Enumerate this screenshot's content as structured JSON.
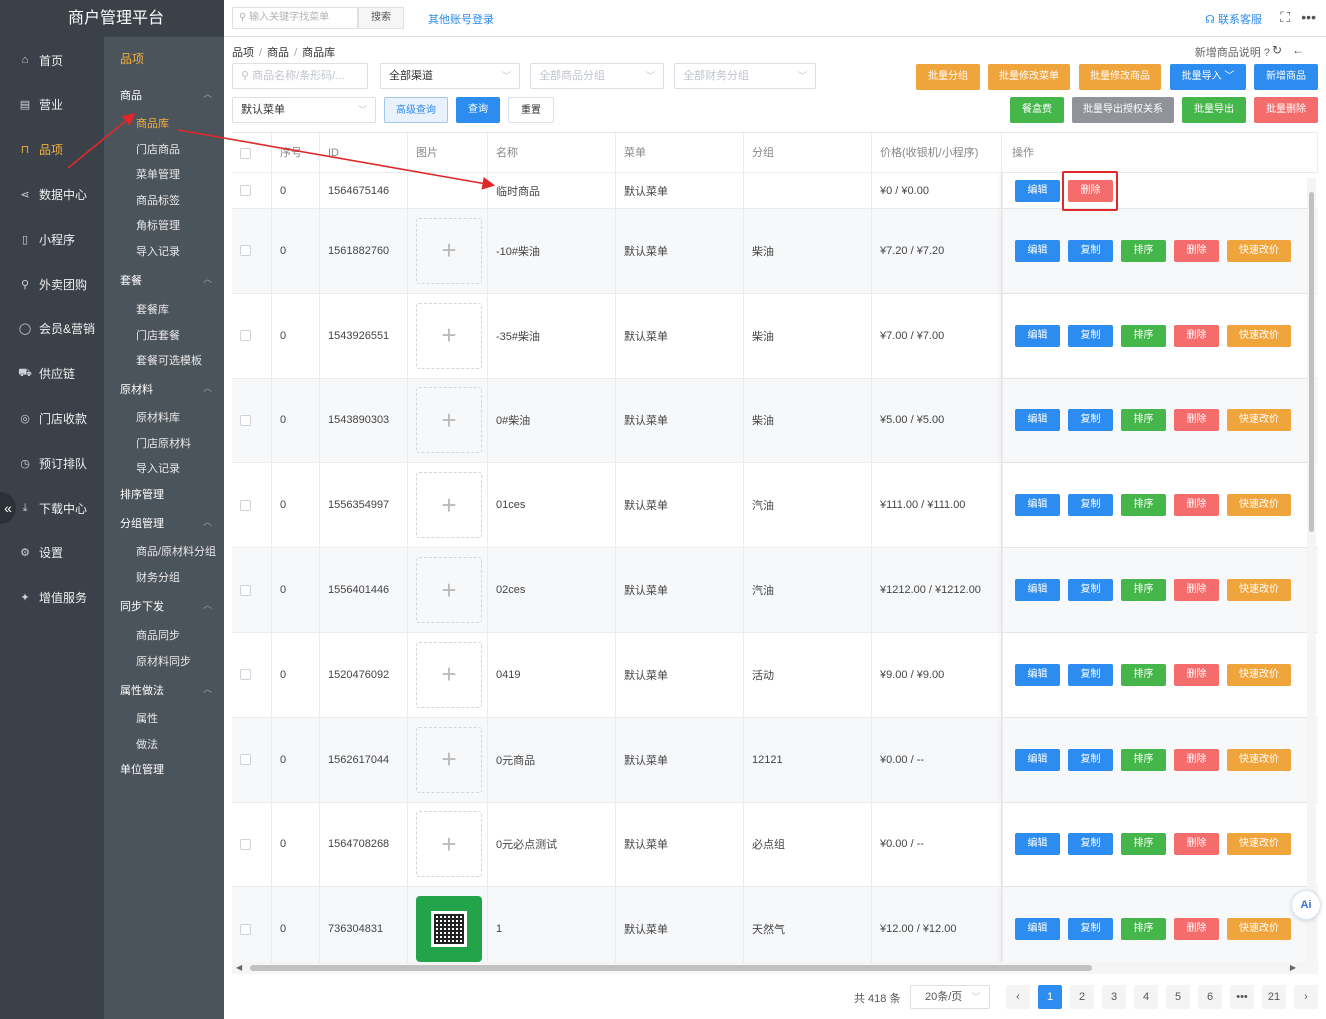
{
  "app": {
    "title": "商户管理平台"
  },
  "nav": [
    {
      "label": "首页",
      "icon": "home-icon"
    },
    {
      "label": "营业",
      "icon": "business-icon"
    },
    {
      "label": "品项",
      "icon": "bag-icon"
    },
    {
      "label": "数据中心",
      "icon": "share-icon"
    },
    {
      "label": "小程序",
      "icon": "phone-icon"
    },
    {
      "label": "外卖团购",
      "icon": "bike-icon"
    },
    {
      "label": "会员&营销",
      "icon": "user-icon"
    },
    {
      "label": "供应链",
      "icon": "truck-icon"
    },
    {
      "label": "门店收款",
      "icon": "coins-icon"
    },
    {
      "label": "预订排队",
      "icon": "clock-icon"
    },
    {
      "label": "下载中心",
      "icon": "download-icon"
    },
    {
      "label": "设置",
      "icon": "gear-icon"
    },
    {
      "label": "增值服务",
      "icon": "gift-icon"
    }
  ],
  "subnav": {
    "head": "品项",
    "goods": "商品",
    "goods_items": [
      "商品库",
      "门店商品",
      "菜单管理",
      "商品标签",
      "角标管理",
      "导入记录"
    ],
    "combo": "套餐",
    "combo_items": [
      "套餐库",
      "门店套餐",
      "套餐可选模板"
    ],
    "material": "原材料",
    "material_items": [
      "原材料库",
      "门店原材料",
      "导入记录"
    ],
    "sort": "排序管理",
    "group": "分组管理",
    "group_items": [
      "商品/原材料分组",
      "财务分组"
    ],
    "sync": "同步下发",
    "sync_items": [
      "商品同步",
      "原材料同步"
    ],
    "attr": "属性做法",
    "attr_items": [
      "属性",
      "做法"
    ],
    "unit": "单位管理"
  },
  "topbar": {
    "search_placeholder": "输入关键字找菜单",
    "search_btn": "搜索",
    "other_login": "其他账号登录",
    "service": "联系客服"
  },
  "breadcrumb": [
    "品项",
    "商品",
    "商品库"
  ],
  "new_tip": "新增商品说明",
  "filters": {
    "name_placeholder": "商品名称/条形码/...",
    "channel": "全部渠道",
    "goods_group": "全部商品分组",
    "finance_group": "全部财务分组",
    "menu": "默认菜单",
    "advanced": "高级查询",
    "query": "查询",
    "reset": "重置"
  },
  "actions_row1": [
    "批量分组",
    "批量修改菜单",
    "批量修改商品",
    "批量导入",
    "新增商品"
  ],
  "actions_row2": [
    "餐盒费",
    "批量导出授权关系",
    "批量导出",
    "批量删除"
  ],
  "columns": [
    "序号",
    "ID",
    "图片",
    "名称",
    "菜单",
    "分组",
    "价格(收银机/小程序)",
    "操作"
  ],
  "ops": {
    "edit": "编辑",
    "copy": "复制",
    "sort": "排序",
    "delete": "删除",
    "quick": "快速改价"
  },
  "rows": [
    {
      "seq": "0",
      "id": "1564675146",
      "img": "none",
      "name": "临时商品",
      "menu": "默认菜单",
      "group": "",
      "price": "¥0 / ¥0.00"
    },
    {
      "seq": "0",
      "id": "1561882760",
      "img": "plus",
      "name": "-10#柴油",
      "menu": "默认菜单",
      "group": "柴油",
      "price": "¥7.20 / ¥7.20"
    },
    {
      "seq": "0",
      "id": "1543926551",
      "img": "plus",
      "name": "-35#柴油",
      "menu": "默认菜单",
      "group": "柴油",
      "price": "¥7.00 / ¥7.00"
    },
    {
      "seq": "0",
      "id": "1543890303",
      "img": "plus",
      "name": "0#柴油",
      "menu": "默认菜单",
      "group": "柴油",
      "price": "¥5.00 / ¥5.00"
    },
    {
      "seq": "0",
      "id": "1556354997",
      "img": "plus",
      "name": "01ces",
      "menu": "默认菜单",
      "group": "汽油",
      "price": "¥111.00 / ¥111.00"
    },
    {
      "seq": "0",
      "id": "1556401446",
      "img": "plus",
      "name": "02ces",
      "menu": "默认菜单",
      "group": "汽油",
      "price": "¥1212.00 / ¥1212.00"
    },
    {
      "seq": "0",
      "id": "1520476092",
      "img": "plus",
      "name": "0419",
      "menu": "默认菜单",
      "group": "活动",
      "price": "¥9.00 / ¥9.00"
    },
    {
      "seq": "0",
      "id": "1562617044",
      "img": "plus",
      "name": "0元商品",
      "menu": "默认菜单",
      "group": "12121",
      "price": "¥0.00 / --"
    },
    {
      "seq": "0",
      "id": "1564708268",
      "img": "plus",
      "name": "0元必点测试",
      "menu": "默认菜单",
      "group": "必点组",
      "price": "¥0.00 / --"
    },
    {
      "seq": "0",
      "id": "736304831",
      "img": "qr",
      "name": "1",
      "menu": "默认菜单",
      "group": "天然气",
      "price": "¥12.00 / ¥12.00"
    }
  ],
  "pagination": {
    "total": "共 418 条",
    "page_size": "20条/页",
    "pages": [
      "1",
      "2",
      "3",
      "4",
      "5",
      "6",
      "•••",
      "21"
    ],
    "current": "1"
  },
  "ai_label": "Ai",
  "colors": {
    "accent": "#f7b13a",
    "primary": "#2d8cf0",
    "annotation": "#e0282a"
  }
}
